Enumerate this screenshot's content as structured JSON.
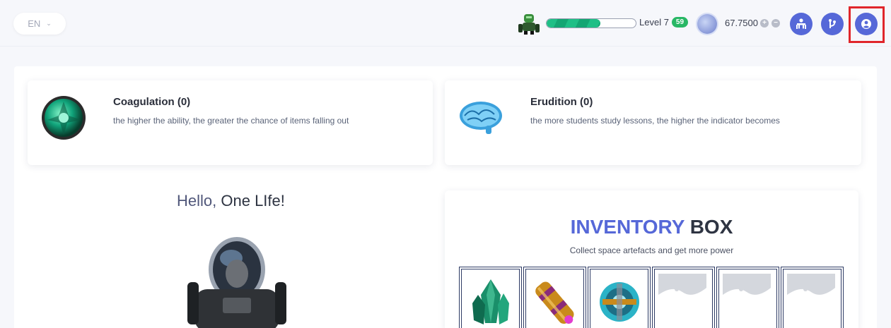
{
  "header": {
    "language": "EN",
    "level_label": "Level 7",
    "level_badge": "59",
    "xp_progress_percent": 60,
    "balance": "67.7500",
    "icons": [
      "robot-icon",
      "coin-icon",
      "plus-icon",
      "minus-icon",
      "teacher-icon",
      "branch-icon",
      "user-icon"
    ]
  },
  "abilities": [
    {
      "title": "Coagulation (0)",
      "description": "the higher the ability, the greater the chance of items falling out"
    },
    {
      "title": "Erudition (0)",
      "description": "the more students study lessons, the higher the indicator becomes"
    }
  ],
  "greeting": {
    "hello": "Hello,",
    "name": "One LIfe!"
  },
  "inventory": {
    "title_a": "INVENTORY",
    "title_b": "BOX",
    "subtitle": "Collect space artefacts and get more power",
    "slots": [
      "crystal",
      "capsule",
      "turbine",
      "empty",
      "empty",
      "empty"
    ]
  },
  "colors": {
    "accent": "#5668d8",
    "xp": "#1fbf86",
    "badge": "#28b765",
    "highlight": "#e0262b"
  }
}
